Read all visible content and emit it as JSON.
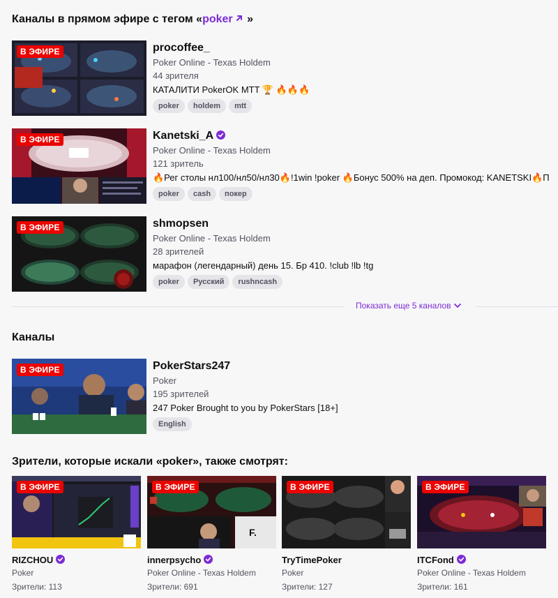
{
  "header": {
    "live_prefix": "Каналы в прямом эфире с тегом «",
    "tag": "poker",
    "live_suffix": " »",
    "channels_title": "Каналы",
    "also_watch_title": "Зрители, которые искали «poker», также смотрят:"
  },
  "live_badge": "В ЭФИРЕ",
  "live_channels": [
    {
      "name": "procoffee_",
      "verified": false,
      "category": "Poker Online - Texas Holdem",
      "viewers": "44 зрителя",
      "title": "КАТАЛИТИ PokerOK MTT 🏆 🔥🔥🔥",
      "tags": [
        "poker",
        "holdem",
        "mtt"
      ]
    },
    {
      "name": "Kanetski_A",
      "verified": true,
      "category": "Poker Online - Texas Holdem",
      "viewers": "121 зритель",
      "title": "🔥Рег столы нл100/нл50/нл30🔥!1win !poker 🔥Бонус 500% на деп. Промокод: KANETSKI🔥П",
      "tags": [
        "poker",
        "cash",
        "покер"
      ]
    },
    {
      "name": "shmopsen",
      "verified": false,
      "category": "Poker Online - Texas Holdem",
      "viewers": "28 зрителей",
      "title": "марафон (легендарный) день 15. Бр 410. !club !lb !tg",
      "tags": [
        "poker",
        "Русский",
        "rushncash"
      ]
    }
  ],
  "show_more": "Показать еще 5 каналов",
  "channel": {
    "name": "PokerStars247",
    "category": "Poker",
    "viewers": "195 зрителей",
    "title": "247 Poker Brought to you by PokerStars [18+]",
    "tags": [
      "English"
    ]
  },
  "recommended": [
    {
      "name": "RIZCHOU",
      "category": "Poker",
      "viewers": "Зрители: 113"
    },
    {
      "name": "innerpsycho",
      "category": "Poker Online - Texas Holdem",
      "viewers": "Зрители: 691"
    },
    {
      "name": "TryTimePoker",
      "category": "Poker",
      "viewers": "Зрители: 127"
    },
    {
      "name": "ITCFond",
      "category": "Poker Online - Texas Holdem",
      "viewers": "Зрители: 161"
    }
  ],
  "colors": {
    "accent": "#7d2bd5",
    "live": "#eb0400",
    "background": "#f7f7f8"
  }
}
